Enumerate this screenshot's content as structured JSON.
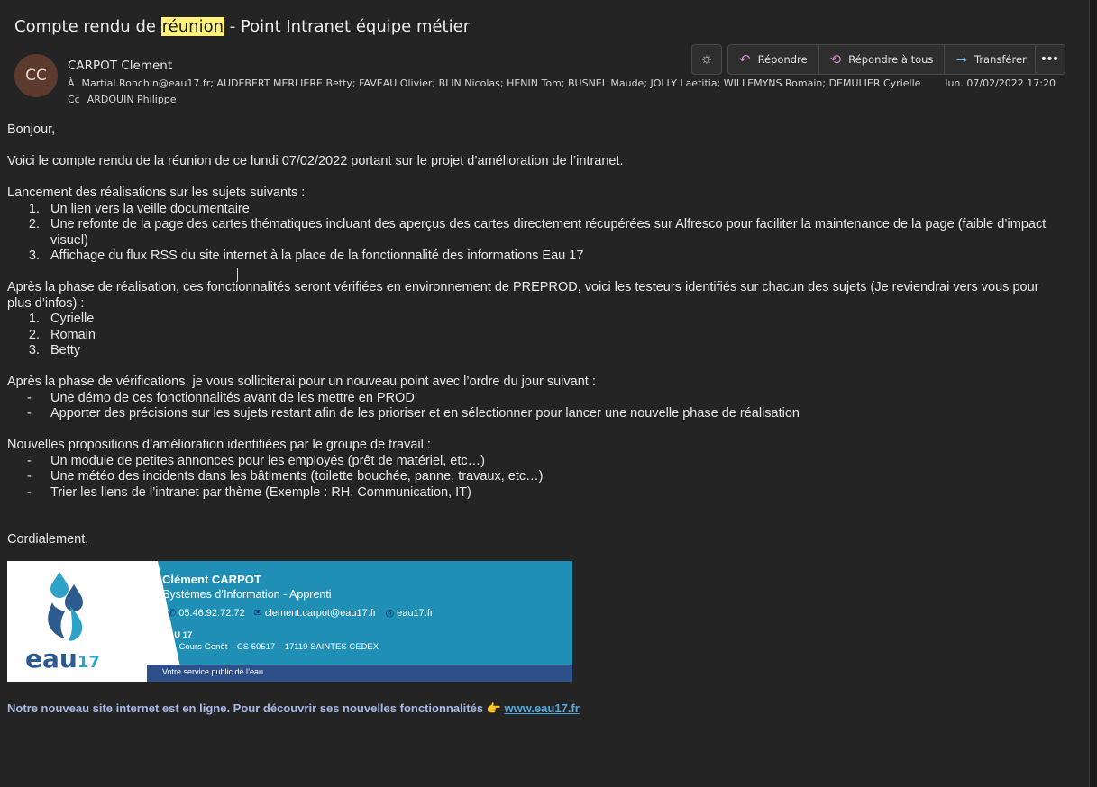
{
  "email": {
    "subject_before": "Compte rendu de ",
    "subject_highlight": "réunion",
    "subject_after": " - Point Intranet équipe métier",
    "avatar_initials": "CC",
    "sender": "CARPOT Clement",
    "to_label": "À",
    "to": "Martial.Ronchin@eau17.fr; AUDEBERT MERLIERE Betty; FAVEAU Olivier; BLIN Nicolas; HENIN Tom; BUSNEL Maude; JOLLY Laetitia; WILLEMYNS Romain; DEMULIER Cyrielle",
    "cc_label": "Cc",
    "cc": "ARDOUIN Philippe",
    "date": "lun. 07/02/2022 17:20"
  },
  "toolbar": {
    "reply": "Répondre",
    "reply_all": "Répondre à tous",
    "forward": "Transférer"
  },
  "body": {
    "greeting": "Bonjour,",
    "intro": "Voici le compte rendu de la réunion de ce lundi 07/02/2022 portant sur le projet d’amélioration de l’intranet.",
    "launch_title": "Lancement des réalisations sur les sujets suivants :",
    "launch_items": [
      {
        "n": "1.",
        "t": "Un lien vers la veille documentaire"
      },
      {
        "n": "2.",
        "t": "Une refonte de la page des cartes thématiques incluant des aperçus des cartes directement récupérées sur Alfresco pour faciliter la maintenance de la page (faible d’impact visuel)"
      },
      {
        "n": "3.",
        "t": "Affichage du flux RSS du site internet à la place de la fonctionnalité des informations Eau 17"
      }
    ],
    "testers_title": "Après la phase de réalisation, ces fonctionnalités seront vérifiées en environnement de PREPROD, voici les testeurs identifiés sur chacun des sujets (Je reviendrai vers vous pour plus d’infos) :",
    "testers": [
      {
        "n": "1.",
        "t": "Cyrielle"
      },
      {
        "n": "2.",
        "t": "Romain"
      },
      {
        "n": "3.",
        "t": "Betty"
      }
    ],
    "next_title": "Après la phase de vérifications, je vous solliciterai pour un nouveau point avec l’ordre du jour suivant :",
    "next_items": [
      {
        "d": "-",
        "t": "Une démo de ces fonctionnalités avant de les mettre en PROD"
      },
      {
        "d": "-",
        "t": "Apporter des précisions sur les sujets restant afin de les prioriser et en sélectionner pour lancer une nouvelle phase de réalisation"
      }
    ],
    "props_title": "Nouvelles propositions d’amélioration identifiées par le groupe de travail :",
    "props_items": [
      {
        "d": "-",
        "t": "Un module de petites annonces pour les employés (prêt de matériel, etc…)"
      },
      {
        "d": "-",
        "t": "Une météo des incidents dans les bâtiments (toilette bouchée, panne, travaux, etc…)"
      },
      {
        "d": "-",
        "t": "Trier les liens de l’intranet par thème (Exemple : RH, Communication, IT)"
      }
    ],
    "closing": "Cordialement,"
  },
  "signature": {
    "name": "Clément CARPOT",
    "role": "Systèmes d’Information - Apprenti",
    "phone": "05.46.92.72.72",
    "email": "clement.carpot@eau17.fr",
    "web": "eau17.fr",
    "org": "EAU 17",
    "address": "131 Cours Genêt – CS 50517 – 17119 SAINTES CEDEX",
    "tagline": "Votre service public de l’eau",
    "logo_word": "eau",
    "logo_num": "17"
  },
  "promo": {
    "text": "Notre nouveau site internet est en ligne. Pour découvrir ses nouvelles fonctionnalités 👉 ",
    "link": "www.eau17.fr"
  },
  "colors": {
    "background": "#242424",
    "highlight": "#fff27a",
    "avatar": "#5c3a2e",
    "signature_blue": "#1f8fb5",
    "signature_dark": "#2d4f8a",
    "promo_text": "#a7b9e8",
    "link": "#4fa8e0"
  }
}
